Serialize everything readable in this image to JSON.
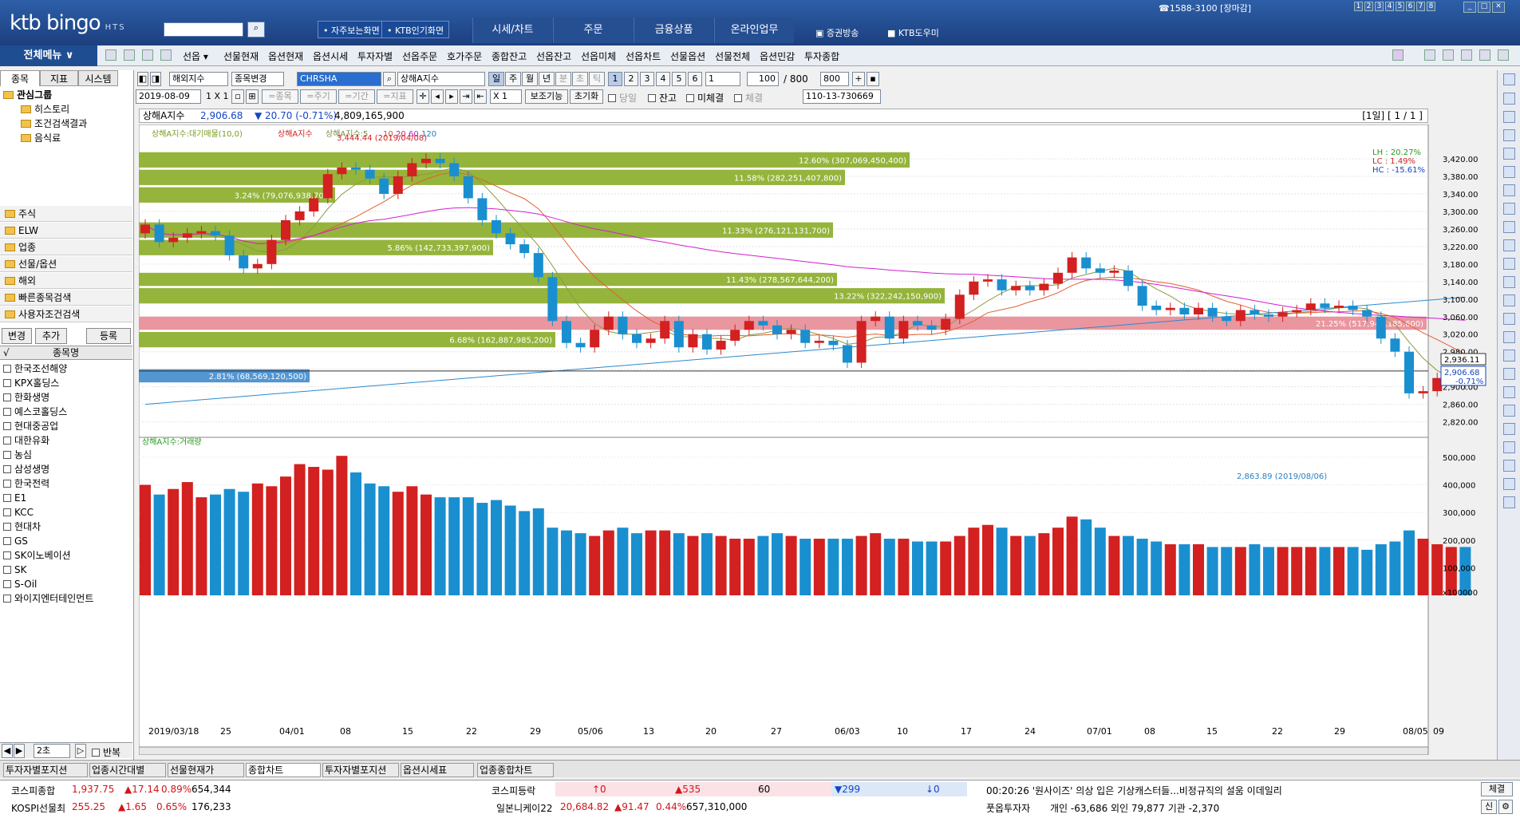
{
  "app": {
    "logo": "ktb bingo",
    "logo_sub": "HTS",
    "phone": "☎1588-3100 [장마감]",
    "num_buttons": [
      "1",
      "2",
      "3",
      "4",
      "5",
      "6",
      "7",
      "8"
    ],
    "quick_links": [
      "• 자주보는화면",
      "• KTB인기화면"
    ],
    "main_menu": [
      "시세/차트",
      "주문",
      "금융상품",
      "온라인업무"
    ],
    "right_links": [
      "증권방송",
      "KTB도우미"
    ]
  },
  "menubar": {
    "all_menu": "전체메뉴 ∨",
    "items": [
      "선옵 ▾",
      "선물현재",
      "옵션현재",
      "옵션시세",
      "투자자별",
      "선옵주문",
      "호가주문",
      "종합잔고",
      "선옵잔고",
      "선옵미체",
      "선옵차트",
      "선물옵션",
      "선물전체",
      "옵션민감",
      "투자종합"
    ]
  },
  "left": {
    "tabs": [
      "종목",
      "지표",
      "시스템"
    ],
    "tree_root": "관심그룹",
    "tree_children": [
      "히스토리",
      "조건검색결과",
      "음식료"
    ],
    "categories": [
      "주식",
      "ELW",
      "업종",
      "선물/옵션",
      "해외",
      "빠른종목검색",
      "사용자조건검색"
    ],
    "buttons": [
      "변경",
      "추가",
      "등록"
    ],
    "list_header": "종목명",
    "stocks": [
      "한국조선해양",
      "KPX홀딩스",
      "한화생명",
      "예스코홀딩스",
      "현대중공업",
      "대한유화",
      "농심",
      "삼성생명",
      "한국전력",
      "E1",
      "KCC",
      "현대차",
      "GS",
      "SK이노베이션",
      "SK",
      "S-Oil",
      "와이지엔터테인먼트"
    ],
    "bottom": {
      "interval": "2초",
      "repeat": "반복"
    }
  },
  "toolbar1": {
    "market": "해외지수",
    "change_label": "종목변경",
    "code": "CHRSHA",
    "name": "상해A지수",
    "periods": [
      "일",
      "주",
      "월",
      "년",
      "분",
      "초",
      "틱"
    ],
    "counts": [
      "1",
      "2",
      "3",
      "4",
      "5",
      "6"
    ],
    "unit": "1",
    "view_count": "100",
    "total": "/ 800",
    "total_box": "800"
  },
  "toolbar2": {
    "date": "2019-08-09",
    "scale": "1 X 1",
    "modes": [
      "=종목",
      "=주기",
      "=기간",
      "=지표"
    ],
    "multiplier": "X  1",
    "aux_func": "보조기능",
    "reset": "초기화",
    "checks": [
      "당일",
      "잔고",
      "미체결",
      "체결"
    ],
    "account": "110-13-730669"
  },
  "info": {
    "name": "상해A지수",
    "price": "2,906.68",
    "change": "▼ 20.70 (-0.71%)",
    "volume": "4,809,165,900",
    "page": "[1일] [ 1 / 1 ]"
  },
  "chart": {
    "legend_price": [
      "상해A지수:대기매물(10,0)",
      "상해A지수",
      "상해A지수:5",
      "10",
      "20",
      "60",
      "120"
    ],
    "legend_volume": "상해A지수:거래량",
    "high_label": "3,444.44 (2019/04/08)",
    "low_label": "2,863.89 (2019/08/06)",
    "lh": "LH :  20.27%",
    "lc": "LC :   1.49%",
    "hc": "HC : -15.61%",
    "last_price_tag": "2,936.11",
    "current_tag": "2,906.68",
    "current_pct": "-0.71%",
    "colors": {
      "up": "#d32020",
      "down": "#1a8fd0",
      "band": "#8fb032",
      "band_hi": "#e8909a",
      "band_cur": "#4a90d0"
    }
  },
  "chart_data": {
    "type": "candlestick",
    "price_axis": [
      "3,420.00",
      "3,380.00",
      "3,340.00",
      "3,300.00",
      "3,260.00",
      "3,220.00",
      "3,180.00",
      "3,140.00",
      "3,100.00",
      "3,060.00",
      "3,020.00",
      "2,980.00",
      "2,940.00",
      "2,900.00",
      "2,860.00",
      "2,820.00"
    ],
    "volume_axis": [
      "500,000",
      "400,000",
      "300,000",
      "200,000",
      "100,000",
      "x100000"
    ],
    "x_labels": [
      "2019/03/18",
      "25",
      "04/01",
      "08",
      "15",
      "22",
      "29",
      "05/06",
      "13",
      "20",
      "27",
      "06/03",
      "10",
      "17",
      "24",
      "07/01",
      "08",
      "15",
      "22",
      "29",
      "08/05",
      "09"
    ],
    "price_bands": [
      {
        "label": "12.60% (307,069,450,400)",
        "pct": 12.6,
        "low": 3400,
        "high": 3435
      },
      {
        "label": "11.58% (282,251,407,800)",
        "pct": 11.58,
        "low": 3360,
        "high": 3395
      },
      {
        "label": "3.24% (79,076,938,700)",
        "pct": 3.24,
        "low": 3320,
        "high": 3355
      },
      {
        "label": "11.33% (276,121,131,700)",
        "pct": 11.33,
        "low": 3240,
        "high": 3275
      },
      {
        "label": "5.86% (142,733,397,900)",
        "pct": 5.86,
        "low": 3200,
        "high": 3235
      },
      {
        "label": "11.43% (278,567,644,200)",
        "pct": 11.43,
        "low": 3130,
        "high": 3160
      },
      {
        "label": "13.22% (322,242,150,900)",
        "pct": 13.22,
        "low": 3090,
        "high": 3125
      },
      {
        "label": "21.25% (517,943,185,600)",
        "pct": 21.25,
        "low": 3030,
        "high": 3060
      },
      {
        "label": "6.68% (162,887,985,200)",
        "pct": 6.68,
        "low": 2990,
        "high": 3025
      },
      {
        "label": "2.81% (68,569,120,500)",
        "pct": 2.81,
        "low": 2910,
        "high": 2940
      }
    ],
    "closes": [
      3270,
      3230,
      3240,
      3250,
      3255,
      3245,
      3200,
      3170,
      3180,
      3235,
      3280,
      3300,
      3330,
      3385,
      3400,
      3395,
      3375,
      3340,
      3380,
      3410,
      3420,
      3410,
      3380,
      3330,
      3280,
      3250,
      3225,
      3205,
      3150,
      3050,
      3000,
      2990,
      3030,
      3060,
      3020,
      3000,
      3010,
      3050,
      2990,
      3020,
      2985,
      3005,
      3030,
      3050,
      3040,
      3020,
      3030,
      3000,
      3005,
      2995,
      2955,
      3050,
      3060,
      3010,
      3050,
      3040,
      3030,
      3055,
      3110,
      3140,
      3145,
      3120,
      3130,
      3120,
      3135,
      3160,
      3195,
      3170,
      3160,
      3165,
      3130,
      3085,
      3075,
      3080,
      3065,
      3080,
      3060,
      3050,
      3075,
      3065,
      3060,
      3070,
      3075,
      3090,
      3080,
      3085,
      3075,
      3060,
      3010,
      2980,
      2885,
      2890,
      2920,
      2930,
      2906
    ],
    "volumes": [
      400,
      365,
      385,
      410,
      355,
      365,
      385,
      375,
      405,
      395,
      430,
      475,
      465,
      455,
      505,
      445,
      405,
      395,
      375,
      395,
      365,
      355,
      355,
      355,
      335,
      345,
      325,
      305,
      315,
      245,
      235,
      225,
      215,
      235,
      245,
      225,
      235,
      235,
      225,
      215,
      225,
      215,
      205,
      205,
      215,
      225,
      215,
      205,
      205,
      205,
      205,
      215,
      225,
      205,
      205,
      195,
      195,
      195,
      215,
      245,
      255,
      245,
      215,
      215,
      225,
      245,
      285,
      275,
      245,
      215,
      215,
      205,
      195,
      185,
      185,
      185,
      175,
      175,
      175,
      185,
      175,
      175,
      175,
      175,
      175,
      175,
      175,
      165,
      185,
      195,
      235,
      205,
      185,
      175,
      175
    ]
  },
  "bottom_tabs": [
    "투자자별포지션",
    "업종시간대별",
    "선물현재가",
    "종합차트",
    "투자자별포지션",
    "옵션시세표",
    "업종종합차트"
  ],
  "ticker": {
    "kospi": {
      "name": "코스피종합",
      "value": "1,937.75",
      "chg": "▲17.14",
      "pct": "0.89%",
      "vol": "654,344"
    },
    "kospi_fut": {
      "name": "KOSPI선물최",
      "value": "255.25",
      "chg": "▲1.65",
      "pct": "0.65%",
      "vol": "176,233"
    },
    "kospi_rate": {
      "name": "코스피등락",
      "up_limit": "↑0",
      "up": "▲535",
      "flat": "60",
      "down": "▼299",
      "down_limit": "↓0"
    },
    "nikkei": {
      "name": "일본니케이22",
      "value": "20,684.82",
      "chg": "▲91.47",
      "pct": "0.44%",
      "vol": "657,310,000"
    },
    "news": "00:20:26  '원사이즈' 의상 입은 기상캐스터들...비정규직의 설움  이데일리",
    "investor": {
      "name": "풋옵투자자",
      "text": "개인  -63,686  외인  79,877  기관  -2,370"
    },
    "btn_check": "체결",
    "btn_new": "신"
  }
}
